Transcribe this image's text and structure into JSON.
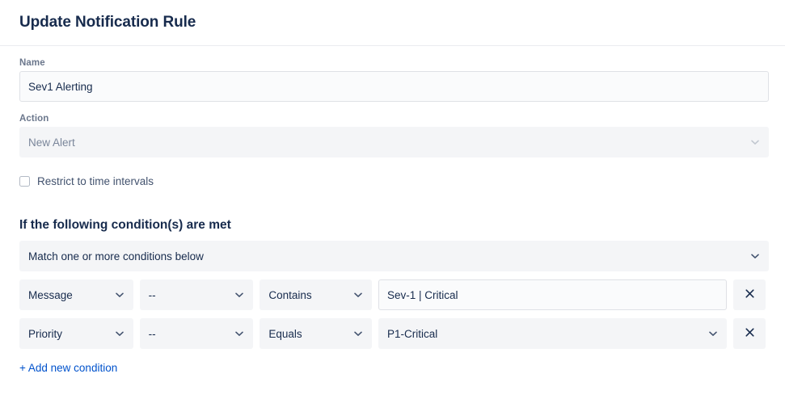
{
  "header": {
    "title": "Update Notification Rule"
  },
  "form": {
    "name": {
      "label": "Name",
      "value": "Sev1 Alerting"
    },
    "action": {
      "label": "Action",
      "value": "New Alert",
      "chevron_icon": "chevron-down-icon"
    },
    "restrict": {
      "label": "Restrict to time intervals",
      "checked": false
    }
  },
  "conditions_section": {
    "heading": "If the following condition(s) are met",
    "match_mode": {
      "value": "Match one or more conditions below",
      "chevron_icon": "chevron-down-icon"
    },
    "rows": [
      {
        "field": "Message",
        "key": "--",
        "operator": "Contains",
        "value": "Sev-1 | Critical",
        "value_type": "input",
        "remove_icon": "close-icon"
      },
      {
        "field": "Priority",
        "key": "--",
        "operator": "Equals",
        "value": "P1-Critical",
        "value_type": "select",
        "remove_icon": "close-icon"
      }
    ],
    "add_link": "+ Add new condition"
  },
  "colors": {
    "text_primary": "#172B4D",
    "text_subtle": "#6B778C",
    "link": "#0052CC",
    "field_bg": "#F4F5F7",
    "input_bg": "#FAFBFC",
    "border": "#DFE1E6"
  }
}
